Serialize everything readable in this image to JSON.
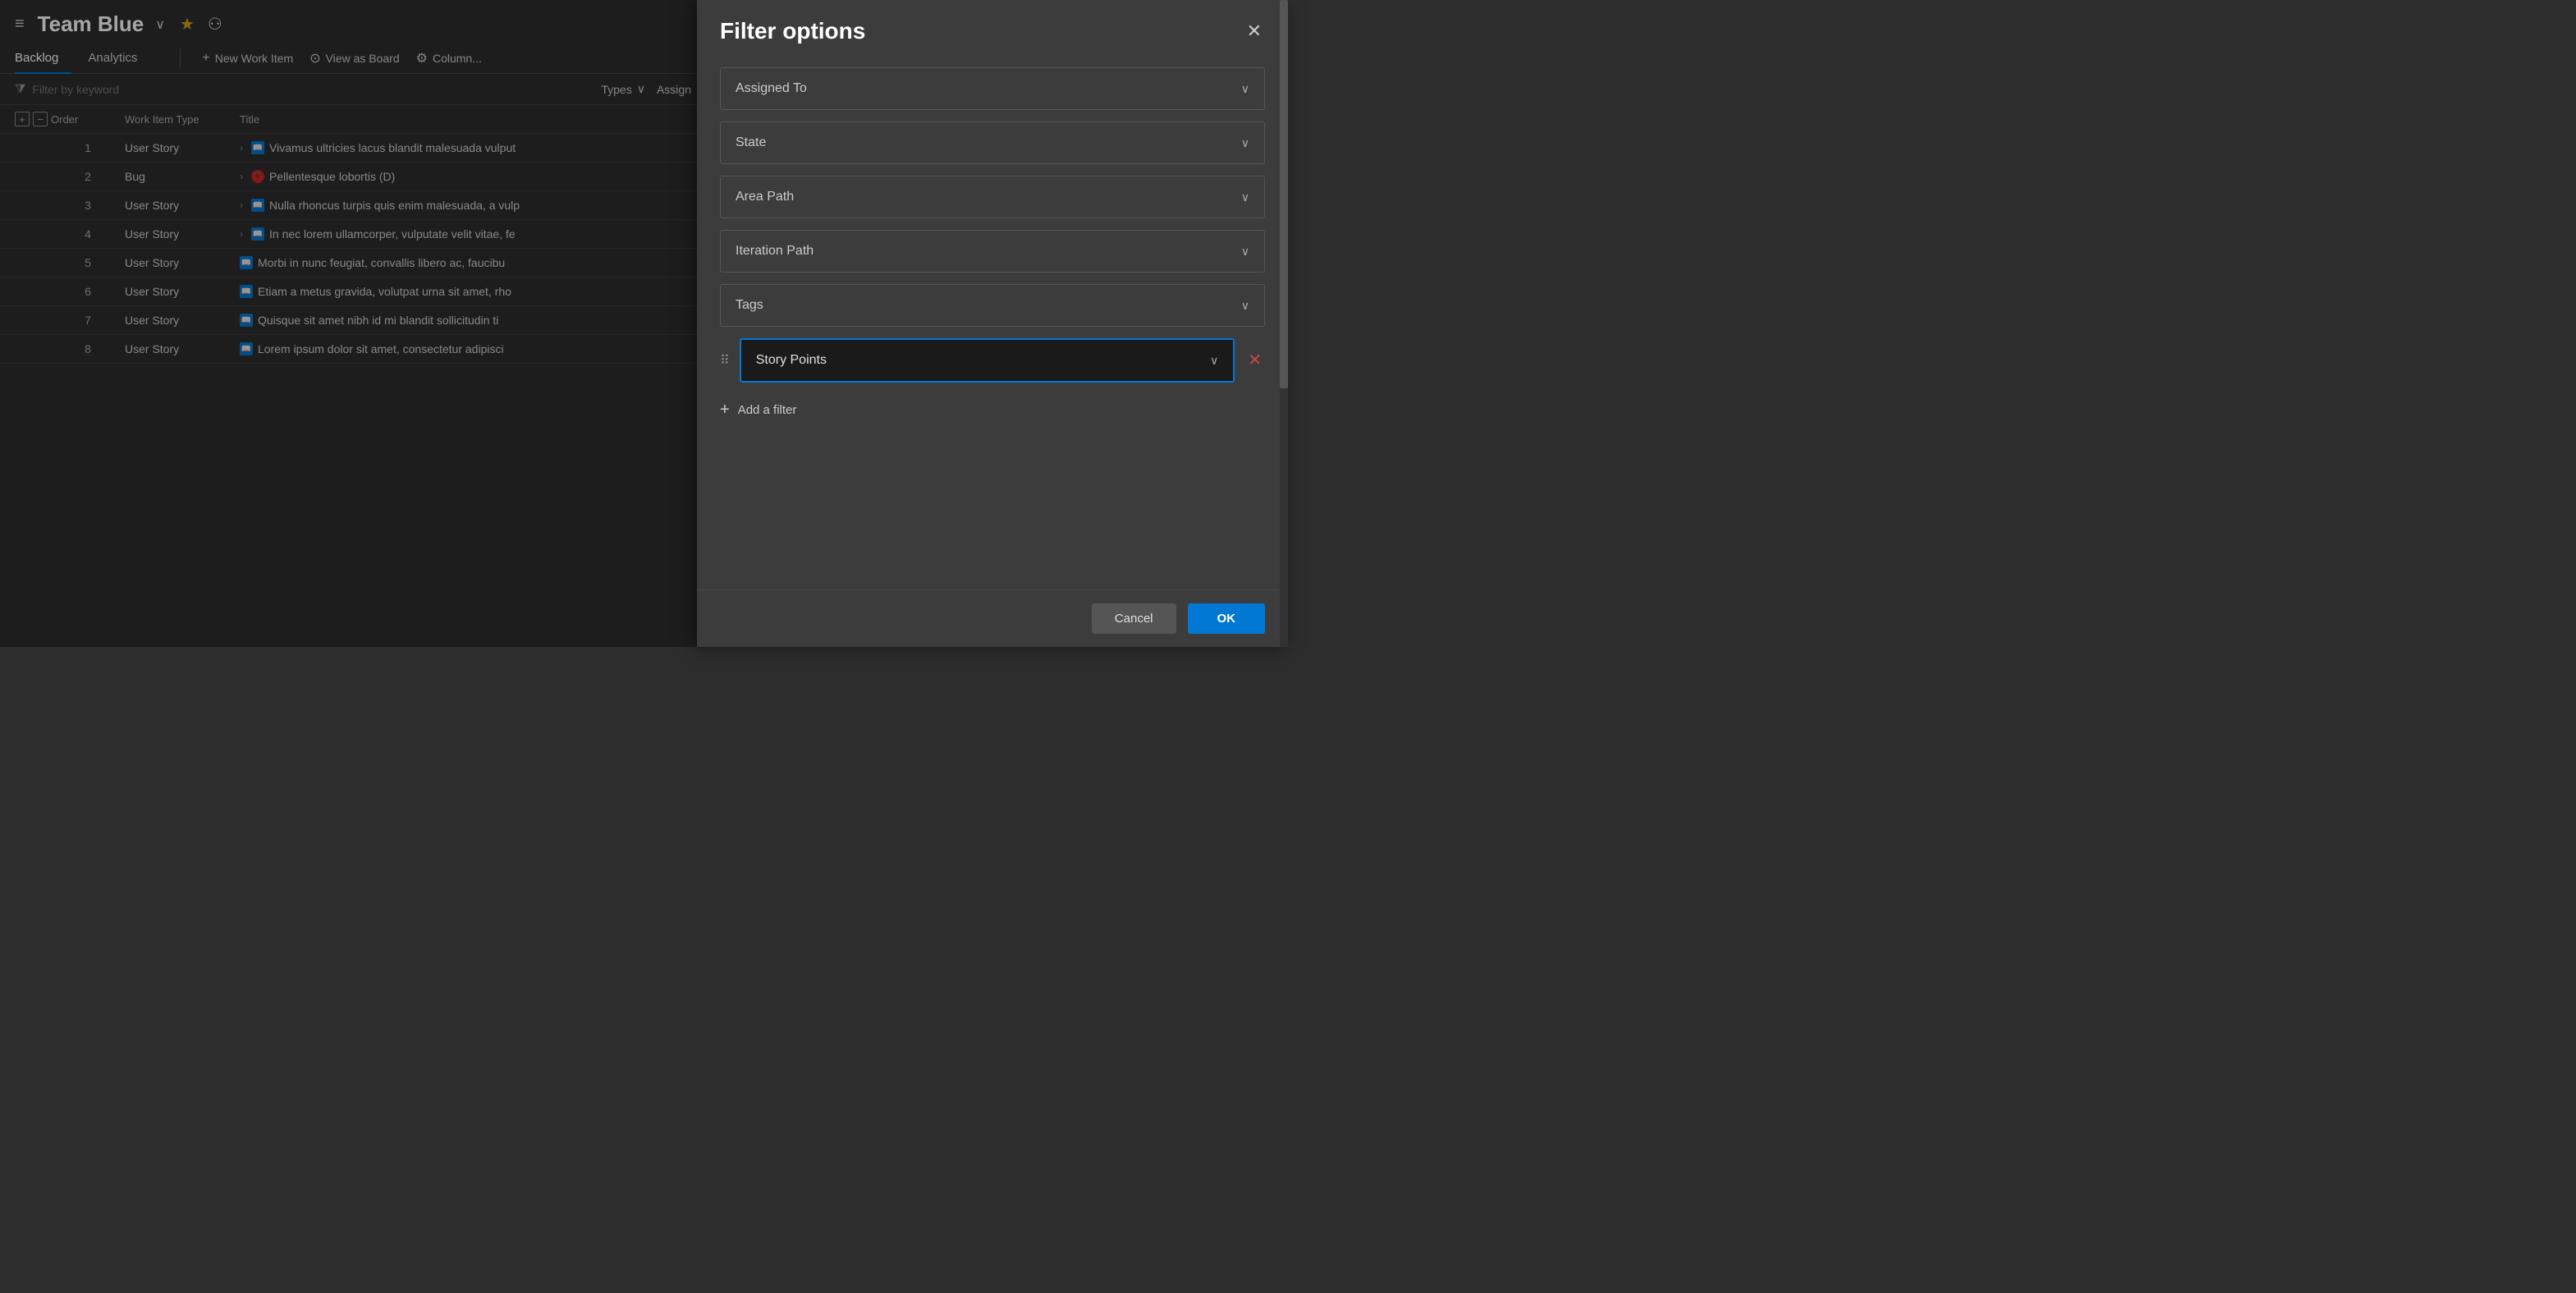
{
  "header": {
    "team_name": "Team Blue",
    "hamburger_label": "≡",
    "chevron": "∨",
    "star": "★",
    "people": "⚇"
  },
  "nav": {
    "tabs": [
      {
        "label": "Backlog",
        "active": true
      },
      {
        "label": "Analytics",
        "active": false
      }
    ],
    "toolbar": [
      {
        "label": "New Work Item",
        "icon": "+",
        "name": "new-work-item"
      },
      {
        "label": "View as Board",
        "icon": "⊙",
        "name": "view-as-board"
      },
      {
        "label": "Column...",
        "icon": "⚙",
        "name": "column-options"
      }
    ]
  },
  "filter_bar": {
    "placeholder": "Filter by keyword",
    "filter_icon": "⧩",
    "pills": [
      {
        "label": "Types",
        "name": "types-filter"
      },
      {
        "label": "Assign",
        "name": "assign-filter"
      }
    ]
  },
  "table": {
    "headers": {
      "order": "Order",
      "type": "Work Item Type",
      "title": "Title"
    },
    "rows": [
      {
        "order": "1",
        "type": "User Story",
        "has_chevron": true,
        "icon": "story",
        "title": "Vivamus ultricies lacus blandit malesuada vulput"
      },
      {
        "order": "2",
        "type": "Bug",
        "has_chevron": true,
        "icon": "bug",
        "title": "Pellentesque lobortis (D)"
      },
      {
        "order": "3",
        "type": "User Story",
        "has_chevron": true,
        "icon": "story",
        "title": "Nulla rhoncus turpis quis enim malesuada, a vulp"
      },
      {
        "order": "4",
        "type": "User Story",
        "has_chevron": true,
        "icon": "story",
        "title": "In nec lorem ullamcorper, vulputate velit vitae, fe"
      },
      {
        "order": "5",
        "type": "User Story",
        "has_chevron": false,
        "icon": "story",
        "title": "Morbi in nunc feugiat, convallis libero ac, faucibu"
      },
      {
        "order": "6",
        "type": "User Story",
        "has_chevron": false,
        "icon": "story",
        "title": "Etiam a metus gravida, volutpat urna sit amet, rho"
      },
      {
        "order": "7",
        "type": "User Story",
        "has_chevron": false,
        "icon": "story",
        "title": "Quisque sit amet nibh id mi blandit sollicitudin ti"
      },
      {
        "order": "8",
        "type": "User Story",
        "has_chevron": false,
        "icon": "story",
        "title": "Lorem ipsum dolor sit amet, consectetur adipisci"
      }
    ]
  },
  "filter_panel": {
    "title": "Filter options",
    "close_label": "✕",
    "filters": [
      {
        "label": "Assigned To",
        "name": "assigned-to-filter",
        "active": false
      },
      {
        "label": "State",
        "name": "state-filter",
        "active": false
      },
      {
        "label": "Area Path",
        "name": "area-path-filter",
        "active": false
      },
      {
        "label": "Iteration Path",
        "name": "iteration-path-filter",
        "active": false
      },
      {
        "label": "Tags",
        "name": "tags-filter",
        "active": false
      }
    ],
    "custom_filter": {
      "label": "Story Points",
      "name": "story-points-filter",
      "active": true
    },
    "add_filter_label": "Add a filter",
    "cancel_label": "Cancel",
    "ok_label": "OK",
    "chevron": "∨",
    "drag_handle": "⠿",
    "delete_icon": "✕"
  }
}
